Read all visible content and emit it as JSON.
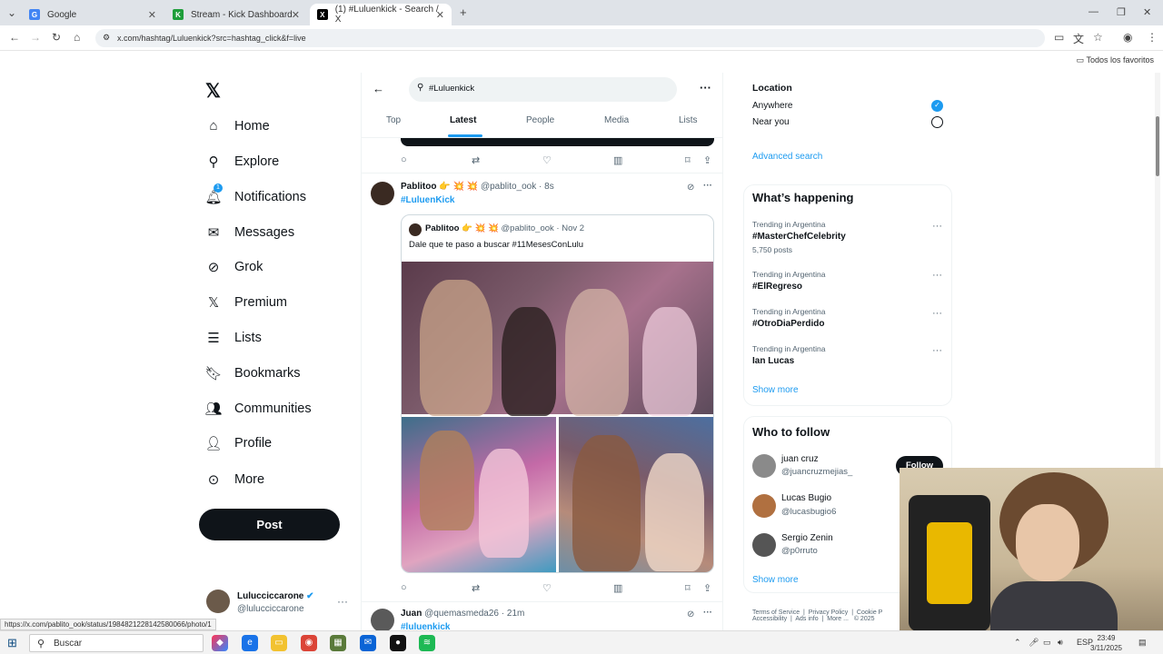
{
  "browser": {
    "tabs": [
      {
        "title": "Google",
        "icon": "google-icon"
      },
      {
        "title": "Stream - Kick Dashboard",
        "icon": "kick-icon"
      },
      {
        "title": "(1) #Luluenkick - Search / X",
        "icon": "x-icon"
      }
    ],
    "url": "x.com/hashtag/Luluenkick?src=hashtag_click&f=live",
    "bookmarks_folder": "Todos los favoritos",
    "status_url": "https://x.com/pablito_ook/status/1984821228142580066/photo/1"
  },
  "nav": {
    "items": [
      {
        "label": "Home",
        "icon": "home-icon"
      },
      {
        "label": "Explore",
        "icon": "search-icon"
      },
      {
        "label": "Notifications",
        "icon": "bell-icon",
        "badge": "1"
      },
      {
        "label": "Messages",
        "icon": "envelope-icon"
      },
      {
        "label": "Grok",
        "icon": "grok-icon"
      },
      {
        "label": "Premium",
        "icon": "x-icon"
      },
      {
        "label": "Lists",
        "icon": "list-icon"
      },
      {
        "label": "Bookmarks",
        "icon": "bookmark-icon"
      },
      {
        "label": "Communities",
        "icon": "people-icon"
      },
      {
        "label": "Profile",
        "icon": "person-icon"
      },
      {
        "label": "More",
        "icon": "more-circle-icon"
      }
    ],
    "post_label": "Post",
    "account": {
      "name": "Lulucciccarone",
      "handle": "@lulucciccarone"
    }
  },
  "search": {
    "query": "#Luluenkick",
    "tabs": [
      "Top",
      "Latest",
      "People",
      "Media",
      "Lists"
    ],
    "active_tab": "Latest"
  },
  "tweets": [
    {
      "name": "Pablitoo",
      "handle": "@pablito_ook",
      "time": "8s",
      "hashtag": "#LuluenKick",
      "quote": {
        "name": "Pablitoo",
        "handle": "@pablito_ook",
        "date": "Nov 2",
        "text": "Dale que te paso a buscar #11MesesConLulu"
      }
    },
    {
      "name": "Juan",
      "handle": "@quemasmeda26",
      "time": "21m",
      "hashtag": "#luluenkick"
    }
  ],
  "right": {
    "location": {
      "title": "Location",
      "options": [
        "Anywhere",
        "Near you"
      ],
      "selected": "Anywhere"
    },
    "advanced_search": "Advanced search",
    "trending_title": "What’s happening",
    "trends": [
      {
        "context": "Trending in Argentina",
        "topic": "#MasterChefCelebrity",
        "posts": "5,750 posts"
      },
      {
        "context": "Trending in Argentina",
        "topic": "#ElRegreso",
        "posts": ""
      },
      {
        "context": "Trending in Argentina",
        "topic": "#OtroDiaPerdido",
        "posts": ""
      },
      {
        "context": "Trending in Argentina",
        "topic": "Ian Lucas",
        "posts": ""
      }
    ],
    "show_more": "Show more",
    "who_to_follow_title": "Who to follow",
    "who_to_follow": [
      {
        "name": "juan cruz",
        "handle": "@juancruzmejias_"
      },
      {
        "name": "Lucas Bugio",
        "handle": "@lucasbugio6"
      },
      {
        "name": "Sergio Zenin",
        "handle": "@p0rruto"
      }
    ],
    "follow_label": "Follow",
    "show_more_2": "Show more",
    "footer": [
      "Terms of Service",
      "Privacy Policy",
      "Cookie P",
      "Accessibility",
      "Ads info",
      "More ...",
      "© 2025"
    ]
  },
  "taskbar": {
    "search_placeholder": "Buscar",
    "lang": "ESP",
    "time": "23:49",
    "date": "3/11/2025"
  }
}
